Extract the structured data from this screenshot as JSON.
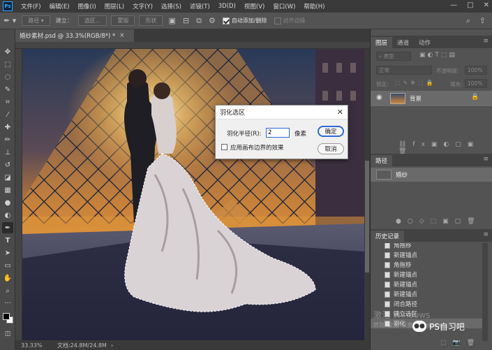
{
  "menubar": {
    "logo": "Ps",
    "items": [
      "文件(F)",
      "编辑(E)",
      "图像(I)",
      "图层(L)",
      "文字(Y)",
      "选择(S)",
      "滤镜(T)",
      "3D(D)",
      "视图(V)",
      "窗口(W)",
      "帮助(H)"
    ],
    "minimize": "—",
    "maximize": "□",
    "close": "✕"
  },
  "options": {
    "path_mode": "路径",
    "build_label": "建立：",
    "selection_btn": "选区...",
    "mask_btn": "蒙版",
    "shape_btn": "形状",
    "auto_add_delete": "自动添加/删除",
    "align_edges": "对齐边缘"
  },
  "document": {
    "tab_title": "婚纱素材.psd @ 33.3%(RGB/8*) *",
    "tab_close": "×",
    "zoom": "33.33%",
    "doc_size": "文档:24.8M/24.8M"
  },
  "layers_panel": {
    "tabs": [
      "图层",
      "通道",
      "动作"
    ],
    "kind_filter": "类型",
    "blend_mode": "正常",
    "opacity_label": "不透明度:",
    "opacity_value": "100%",
    "lock_label": "锁定:",
    "fill_label": "填充:",
    "fill_value": "100%",
    "layer_name": "背景"
  },
  "paths_panel": {
    "tab": "路径",
    "path_name": "婚纱"
  },
  "history_panel": {
    "tab": "历史记录",
    "items": [
      "角拖移",
      "新建锚点",
      "角拖移",
      "新建锚点",
      "新建锚点",
      "新建锚点",
      "闭合路径",
      "建立选区",
      "羽化"
    ]
  },
  "feather_dialog": {
    "title": "羽化选区",
    "radius_label": "羽化半径(R):",
    "radius_value": "2",
    "unit": "像素",
    "ok": "确定",
    "cancel": "取消",
    "apply_canvas_bounds": "应用画布边界的效果",
    "apply_canvas_bounds_checked": false
  },
  "watermark": {
    "activate": "激活 Windows",
    "goto_settings": "转到“设置”以激活 Windows。",
    "brand": "PS自习吧"
  }
}
